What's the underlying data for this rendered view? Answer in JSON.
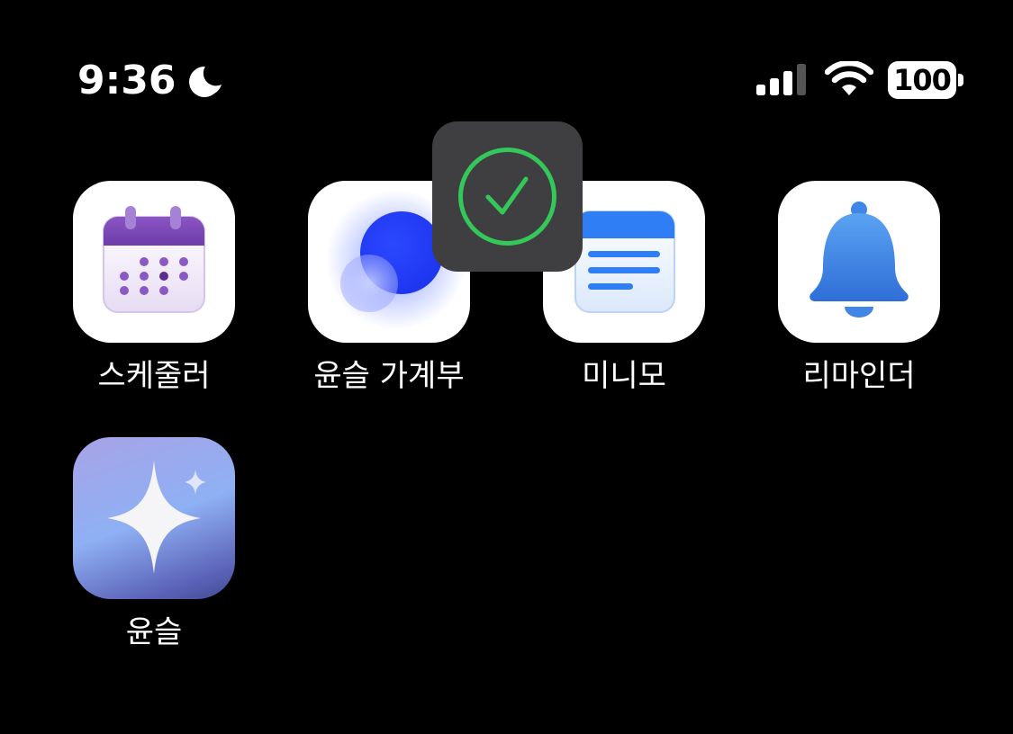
{
  "status_bar": {
    "time": "9:36",
    "focus_icon": "moon-icon",
    "signal_icon": "cellular-signal-icon",
    "wifi_icon": "wifi-icon",
    "battery_level": "100"
  },
  "hud": {
    "icon": "checkmark-circle-icon",
    "accent_color": "#34c759"
  },
  "apps": [
    {
      "label": "스케줄러",
      "icon": "calendar-icon"
    },
    {
      "label": "윤슬 가계부",
      "icon": "blue-orb-icon"
    },
    {
      "label": "미니모",
      "icon": "notes-icon"
    },
    {
      "label": "리마인더",
      "icon": "bell-icon"
    },
    {
      "label": "윤슬",
      "icon": "sparkle-icon"
    }
  ],
  "colors": {
    "background": "#000000",
    "calendar_purple": "#7d4bb5",
    "notes_blue": "#2f7ef5",
    "bell_blue": "#3b82e8"
  }
}
